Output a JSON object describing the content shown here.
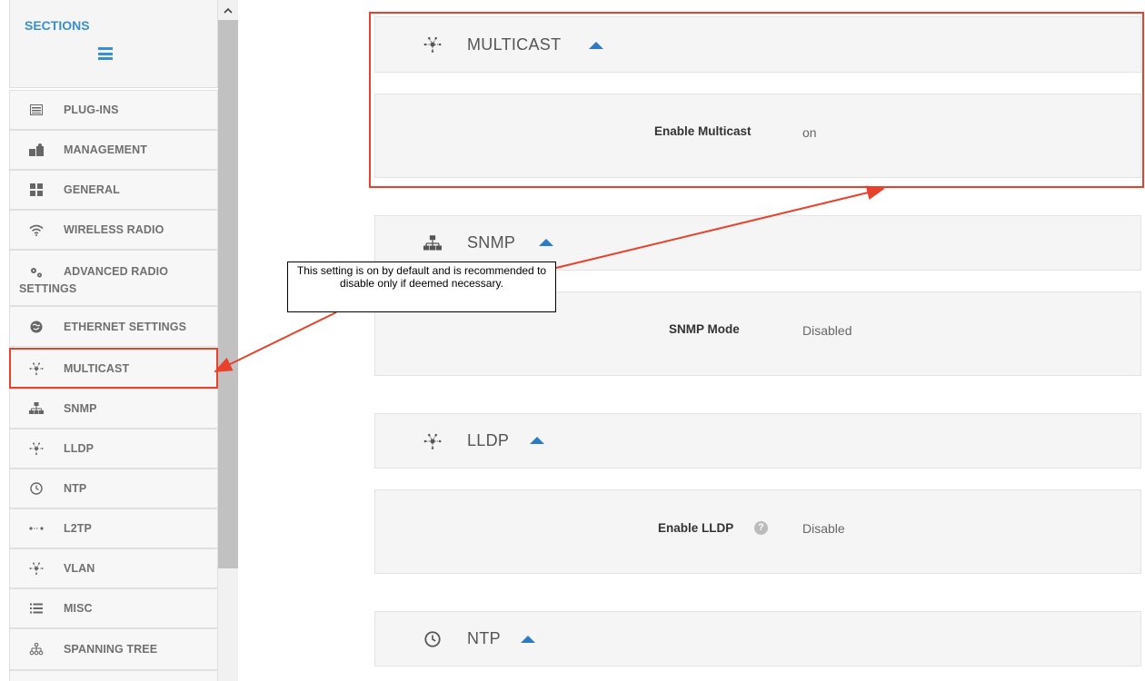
{
  "sidebar": {
    "title": "SECTIONS",
    "items": [
      {
        "label": "PLUG-INS",
        "icon": "list-icon"
      },
      {
        "label": "MANAGEMENT",
        "icon": "management-icon"
      },
      {
        "label": "GENERAL",
        "icon": "grid-icon"
      },
      {
        "label": "WIRELESS RADIO",
        "icon": "wifi-icon"
      },
      {
        "label": "ADVANCED RADIO SETTINGS",
        "icon": "gears-icon"
      },
      {
        "label": "ETHERNET SETTINGS",
        "icon": "ethernet-icon"
      },
      {
        "label": "MULTICAST",
        "icon": "multicast-icon"
      },
      {
        "label": "SNMP",
        "icon": "network-tree-icon"
      },
      {
        "label": "LLDP",
        "icon": "multicast-icon"
      },
      {
        "label": "NTP",
        "icon": "clock-icon"
      },
      {
        "label": "L2TP",
        "icon": "dots-icon"
      },
      {
        "label": "VLAN",
        "icon": "multicast-icon"
      },
      {
        "label": "MISC",
        "icon": "list-icon"
      },
      {
        "label": "SPANNING TREE",
        "icon": "tree-icon"
      }
    ]
  },
  "main": {
    "multicast": {
      "title": "MULTICAST",
      "field_label": "Enable Multicast",
      "field_value": "on"
    },
    "snmp": {
      "title": "SNMP",
      "field_label": "SNMP Mode",
      "field_value": "Disabled"
    },
    "lldp": {
      "title": "LLDP",
      "field_label": "Enable LLDP",
      "field_value": "Disable"
    },
    "ntp": {
      "title": "NTP"
    }
  },
  "callout": {
    "text": "This setting is on by default and is recommended to disable only if deemed necessary."
  },
  "colors": {
    "accent": "#3a8fd0",
    "caret": "#2d7bc4",
    "annotation": "#e8412c"
  }
}
